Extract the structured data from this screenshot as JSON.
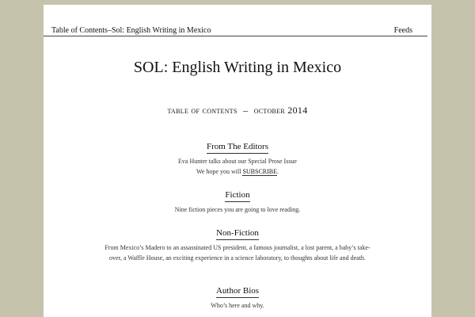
{
  "topbar": {
    "breadcrumb": "Table of Contents–Sol: English Writing in Mexico",
    "feeds": "Feeds"
  },
  "header": {
    "site_title": "SOL: English Writing in Mexico",
    "subtitle_left": "table of contents",
    "subtitle_dash": "–",
    "subtitle_month": "october",
    "subtitle_year": "2014"
  },
  "sections": [
    {
      "heading": "From The Editors",
      "description": "Eva Hunter talks about our Special Prose Issue",
      "line2_prefix": "We hope you will ",
      "line2_link": "SUBSCRIBE",
      "line2_suffix": "."
    },
    {
      "heading": "Fiction",
      "description": "Nine fiction pieces you are going to love reading."
    },
    {
      "heading": "Non-Fiction",
      "description": "From Mexico’s Madero to an assassinated US president, a famous journalist, a lost parent, a baby’s take-over, a Waffle House, an exciting experience in a science laboratory, to thoughts about life and death."
    },
    {
      "heading": "Author Bios",
      "description": "Who’s here and why."
    }
  ]
}
